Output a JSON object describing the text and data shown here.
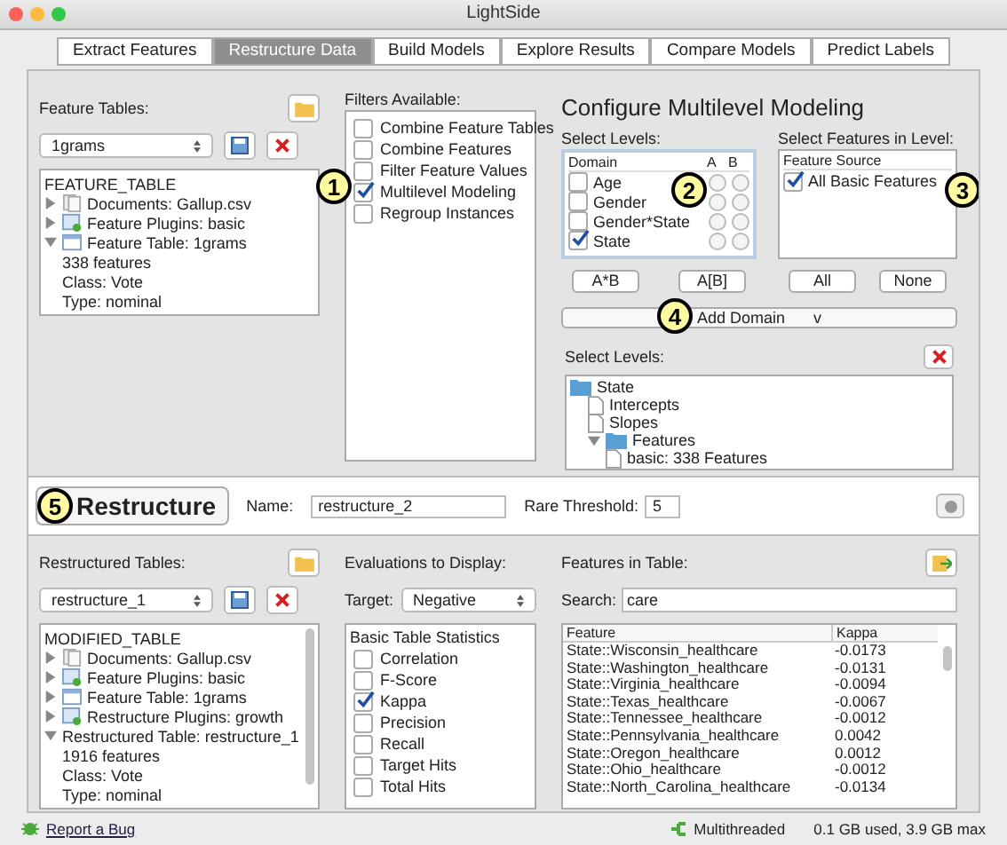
{
  "window": {
    "title": "LightSide"
  },
  "tabs": [
    {
      "label": "Extract Features",
      "selected": false
    },
    {
      "label": "Restructure Data",
      "selected": true
    },
    {
      "label": "Build Models",
      "selected": false
    },
    {
      "label": "Explore Results",
      "selected": false
    },
    {
      "label": "Compare Models",
      "selected": false
    },
    {
      "label": "Predict Labels",
      "selected": false
    }
  ],
  "feature_tables": {
    "label": "Feature Tables:",
    "selected_table": "1grams",
    "tree": {
      "label": "FEATURE_TABLE",
      "children": [
        {
          "label": "Documents: Gallup.csv",
          "kind": "documents",
          "expanded": false
        },
        {
          "label": "Feature Plugins: basic",
          "kind": "plugin",
          "expanded": false
        },
        {
          "label": "Feature Table: 1grams",
          "kind": "table",
          "expanded": true,
          "children": [
            {
              "label": "338 features"
            },
            {
              "label": "Class: Vote"
            },
            {
              "label": "Type: nominal"
            }
          ]
        }
      ]
    }
  },
  "filters": {
    "label": "Filters Available:",
    "callout": "1",
    "items": [
      {
        "label": "Combine Feature Tables",
        "checked": false
      },
      {
        "label": "Combine Features",
        "checked": false
      },
      {
        "label": "Filter Feature Values",
        "checked": false
      },
      {
        "label": "Multilevel Modeling",
        "checked": true
      },
      {
        "label": "Regroup Instances",
        "checked": false
      }
    ]
  },
  "config": {
    "title": "Configure Multilevel Modeling",
    "levels": {
      "label": "Select Levels:",
      "callout": "2",
      "columns": [
        "Domain",
        "A",
        "B"
      ],
      "rows": [
        {
          "label": "Age",
          "checked": false,
          "a": false,
          "b": false
        },
        {
          "label": "Gender",
          "checked": false,
          "a": false,
          "b": false
        },
        {
          "label": "Gender*State",
          "checked": false,
          "a": false,
          "b": false
        },
        {
          "label": "State",
          "checked": true,
          "a": false,
          "b": false
        }
      ]
    },
    "features": {
      "label": "Select Features in Level:",
      "callout": "3",
      "column": "Feature Source",
      "rows": [
        {
          "label": "All Basic Features",
          "checked": true
        }
      ]
    },
    "buttons": [
      "A*B",
      "A[B]",
      "All",
      "None"
    ],
    "add_domain": {
      "callout": "4",
      "label": "Add Domain",
      "caret": "v"
    },
    "levels_tree": {
      "label": "Select Levels:",
      "tree": [
        {
          "label": "State",
          "kind": "folder",
          "children": [
            {
              "label": "Intercepts",
              "kind": "file"
            },
            {
              "label": "Slopes",
              "kind": "file"
            },
            {
              "label": "Features",
              "kind": "folder",
              "expanded": true,
              "children": [
                {
                  "label": "basic: 338 Features",
                  "kind": "file"
                }
              ]
            }
          ]
        }
      ]
    }
  },
  "restructure": {
    "callout": "5",
    "button": "Restructure",
    "name_label": "Name:",
    "name_value": "restructure_2",
    "threshold_label": "Rare Threshold:",
    "threshold_value": "5"
  },
  "restructured_tables": {
    "label": "Restructured Tables:",
    "selected_table": "restructure_1",
    "tree": {
      "label": "MODIFIED_TABLE",
      "children": [
        {
          "label": "Documents: Gallup.csv",
          "kind": "documents",
          "expanded": false
        },
        {
          "label": "Feature Plugins: basic",
          "kind": "plugin",
          "expanded": false
        },
        {
          "label": "Feature Table: 1grams",
          "kind": "table",
          "expanded": false
        },
        {
          "label": "Restructure Plugins: growth",
          "kind": "plugin",
          "expanded": false
        },
        {
          "label": "Restructured Table: restructure_1",
          "kind": "none",
          "expanded": true,
          "children": [
            {
              "label": "1916 features"
            },
            {
              "label": "Class: Vote"
            },
            {
              "label": "Type: nominal"
            }
          ]
        }
      ]
    }
  },
  "evaluations": {
    "label": "Evaluations to Display:",
    "target_label": "Target:",
    "target_value": "Negative",
    "group": "Basic Table Statistics",
    "items": [
      {
        "label": "Correlation",
        "checked": false
      },
      {
        "label": "F-Score",
        "checked": false
      },
      {
        "label": "Kappa",
        "checked": true
      },
      {
        "label": "Precision",
        "checked": false
      },
      {
        "label": "Recall",
        "checked": false
      },
      {
        "label": "Target Hits",
        "checked": false
      },
      {
        "label": "Total Hits",
        "checked": false
      }
    ]
  },
  "features_in_table": {
    "label": "Features in Table:",
    "search_label": "Search:",
    "search_value": "care",
    "columns": [
      "Feature",
      "Kappa"
    ],
    "rows": [
      [
        "State::Wisconsin_healthcare",
        "-0.0173"
      ],
      [
        "State::Washington_healthcare",
        "-0.0131"
      ],
      [
        "State::Virginia_healthcare",
        "-0.0094"
      ],
      [
        "State::Texas_healthcare",
        "-0.0067"
      ],
      [
        "State::Tennessee_healthcare",
        "-0.0012"
      ],
      [
        "State::Pennsylvania_healthcare",
        "0.0042"
      ],
      [
        "State::Oregon_healthcare",
        "0.0012"
      ],
      [
        "State::Ohio_healthcare",
        "-0.0012"
      ],
      [
        "State::North_Carolina_healthcare",
        "-0.0134"
      ]
    ]
  },
  "status_bar": {
    "report": "Report a Bug",
    "mode": "Multithreaded",
    "memory": "0.1 GB used, 3.9 GB max"
  }
}
